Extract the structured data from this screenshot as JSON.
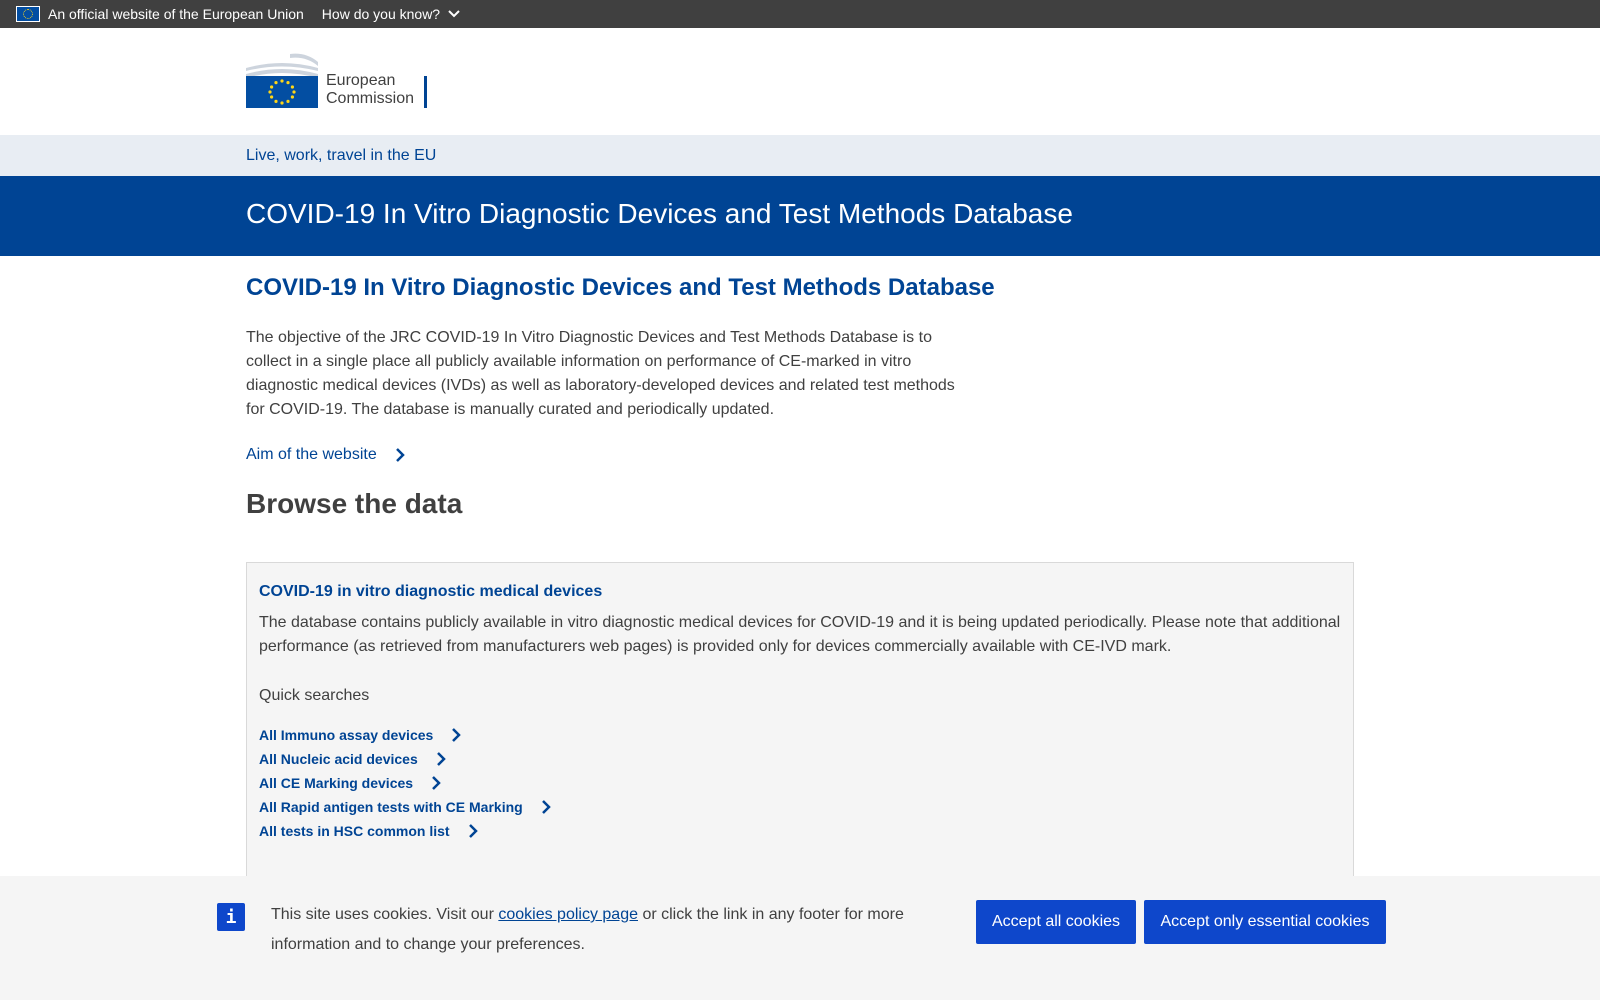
{
  "topbar": {
    "official_text": "An official website of the European Union",
    "how_do_you_know": "How do you know?"
  },
  "logo": {
    "line1": "European",
    "line2": "Commission"
  },
  "site_nav": {
    "link": "Live, work, travel in the EU"
  },
  "banner": {
    "title": "COVID-19 In Vitro Diagnostic Devices and Test Methods Database"
  },
  "main": {
    "heading": "COVID-19 In Vitro Diagnostic Devices and Test Methods Database",
    "intro": "The objective of the JRC COVID-19 In Vitro Diagnostic Devices and Test Methods Database is to collect in a single place all publicly available information on performance of CE-marked in vitro diagnostic medical devices (IVDs) as well as laboratory-developed devices and related test methods for COVID-19. The database is manually curated and periodically updated.",
    "aim_link": "Aim of the website",
    "browse_heading": "Browse the data"
  },
  "card": {
    "title": "COVID-19 in vitro diagnostic medical devices",
    "description": "The database contains publicly available in vitro diagnostic medical devices for COVID-19 and it is being updated periodically. Please note that additional performance (as retrieved from manufacturers web pages) is provided only for devices commercially available with CE-IVD mark.",
    "quick_searches_label": "Quick searches",
    "quick_searches": [
      "All Immuno assay devices",
      "All Nucleic acid devices",
      "All CE Marking devices",
      "All Rapid antigen tests with CE Marking",
      "All tests in HSC common list"
    ]
  },
  "cookie": {
    "text_before": "This site uses cookies. Visit our ",
    "link": "cookies policy page",
    "text_after": " or click the link in any footer for more information and to change your preferences.",
    "accept_all": "Accept all cookies",
    "accept_essential": "Accept only essential cookies"
  },
  "colors": {
    "primary": "#004494",
    "button": "#0e47cb",
    "topbar": "#404040"
  }
}
